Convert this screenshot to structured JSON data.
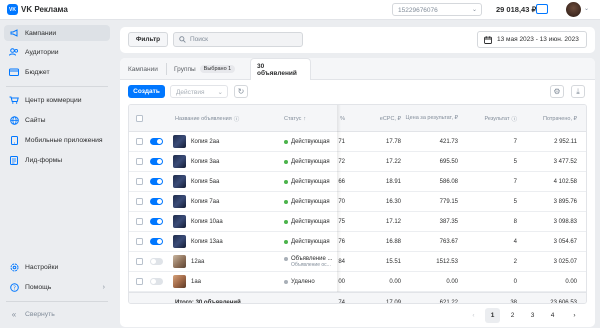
{
  "app": {
    "logo_badge": "VK",
    "title": "VK Реклама"
  },
  "header": {
    "account_id": "15229676076",
    "balance": "29 018,43 ₽"
  },
  "sidebar": {
    "items": [
      {
        "label": "Кампании",
        "icon": "megaphone-icon",
        "active": true
      },
      {
        "label": "Аудитории",
        "icon": "users-icon"
      },
      {
        "label": "Бюджет",
        "icon": "wallet-icon"
      },
      {
        "label": "Центр коммерции",
        "icon": "cart-icon"
      },
      {
        "label": "Сайты",
        "icon": "globe-icon"
      },
      {
        "label": "Мобильные приложения",
        "icon": "phone-icon"
      },
      {
        "label": "Лид-формы",
        "icon": "form-icon"
      }
    ],
    "bottom": [
      {
        "label": "Настройки",
        "icon": "gear-icon"
      },
      {
        "label": "Помощь",
        "icon": "help-icon"
      },
      {
        "label": "Свернуть",
        "icon": "collapse-icon"
      }
    ]
  },
  "toolbar": {
    "filter_label": "Фильтр",
    "search_placeholder": "Поиск",
    "date_range": "13 мая 2023 - 13 июн. 2023"
  },
  "tabs": [
    {
      "label": "Кампании"
    },
    {
      "label": "Группы",
      "badge": "Выбрано 1"
    },
    {
      "label": "30 объявлений",
      "active": true
    }
  ],
  "actions": {
    "create_label": "Создать",
    "actions_placeholder": "Действия"
  },
  "table": {
    "headers": {
      "name": "Название объявления",
      "status": "Статус",
      "pct": "%",
      "ecpc": "eCPC, ₽",
      "price_per_result": "Цена за результат, ₽",
      "result": "Результат",
      "spent": "Потрачено, ₽"
    },
    "rows": [
      {
        "name": "Копия 2аа",
        "status": "Действующая",
        "pct": "71",
        "ecpc": "17.78",
        "ppr": "421.73",
        "result": "7",
        "spent": "2 952.11",
        "on": true,
        "thumb": "dark"
      },
      {
        "name": "Копия 3аа",
        "status": "Действующая",
        "pct": "72",
        "ecpc": "17.22",
        "ppr": "695.50",
        "result": "5",
        "spent": "3 477.52",
        "on": true,
        "thumb": "dark"
      },
      {
        "name": "Копия 5аа",
        "status": "Действующая",
        "pct": "66",
        "ecpc": "18.91",
        "ppr": "586.08",
        "result": "7",
        "spent": "4 102.58",
        "on": true,
        "thumb": "dark"
      },
      {
        "name": "Копия 7аа",
        "status": "Действующая",
        "pct": "70",
        "ecpc": "16.30",
        "ppr": "779.15",
        "result": "5",
        "spent": "3 895.76",
        "on": true,
        "thumb": "dark"
      },
      {
        "name": "Копия 10аа",
        "status": "Действующая",
        "pct": "75",
        "ecpc": "17.12",
        "ppr": "387.35",
        "result": "8",
        "spent": "3 098.83",
        "on": true,
        "thumb": "dark"
      },
      {
        "name": "Копия 13аа",
        "status": "Действующая",
        "pct": "76",
        "ecpc": "16.88",
        "ppr": "763.67",
        "result": "4",
        "spent": "3 054.67",
        "on": true,
        "thumb": "dark"
      },
      {
        "name": "12аа",
        "status": "Объявление ...",
        "status_sub": "Объявление ос...",
        "pct": "84",
        "ecpc": "15.51",
        "ppr": "1512.53",
        "result": "2",
        "spent": "3 025.07",
        "on": false,
        "thumb": "alt"
      },
      {
        "name": "1аа",
        "status": "Удалено",
        "pct": "00",
        "ecpc": "0.00",
        "ppr": "0.00",
        "result": "0",
        "spent": "0.00",
        "on": false,
        "thumb": "alt2"
      }
    ],
    "total": {
      "label": "Итого: 30 объявлений",
      "pct": "74",
      "ecpc": "17.09",
      "ppr": "621.22",
      "result": "38",
      "spent": "23 606.53"
    }
  },
  "pagination": {
    "pages": [
      "1",
      "2",
      "3",
      "4"
    ],
    "current": "1"
  },
  "colors": {
    "accent": "#0077ff",
    "status_active": "#4bb34b",
    "status_inactive": "#a8afb7"
  }
}
